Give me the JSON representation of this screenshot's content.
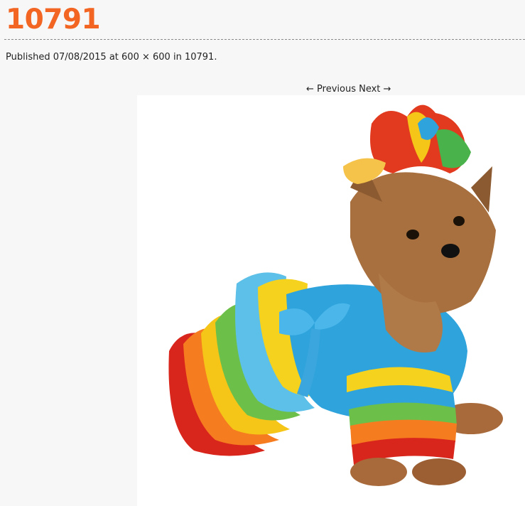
{
  "post": {
    "title": "10791",
    "published_prefix": "Published",
    "date": "07/08/2015",
    "at_text": "at",
    "size": "600 × 600",
    "in_text": "in",
    "parent": "10791",
    "trailing": "."
  },
  "nav": {
    "previous": "← Previous",
    "next": "Next →"
  },
  "colors": {
    "title": "#f26522",
    "background": "#f7f7f7"
  }
}
